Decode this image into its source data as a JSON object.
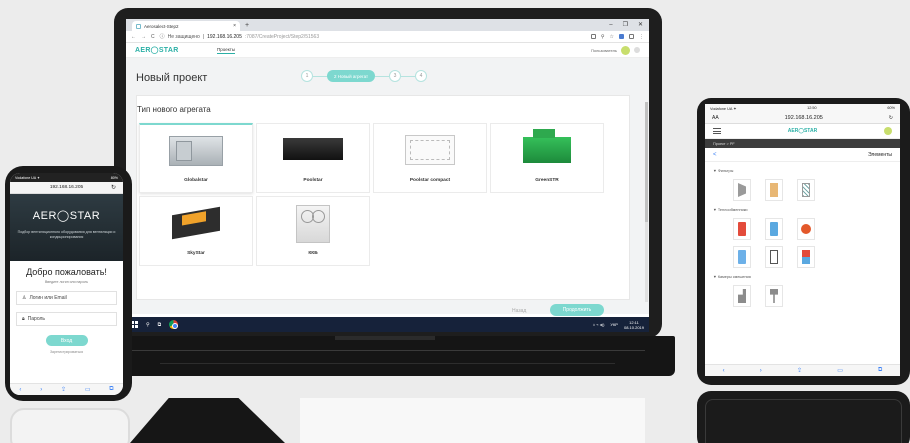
{
  "laptop": {
    "browser": {
      "tab_title": "Aerosalect-Step2",
      "new_tab": "+",
      "window_controls": [
        "–",
        "❐",
        "✕"
      ],
      "security_label": "Не защищено",
      "url_host": "192.168.16.205",
      "url_path": ":7087/CreateProject/Step2/51563"
    },
    "app": {
      "logo": "AER◯STAR",
      "nav_projects": "Проекты",
      "user_name": "Пользователь",
      "page_title": "Новый проект",
      "steps": {
        "first": "1",
        "active": "2 Новый агрегат",
        "third": "3",
        "fourth": "4"
      },
      "section_title": "Тип нового агрегата",
      "units": [
        {
          "name": "Globalstar"
        },
        {
          "name": "Poolstar"
        },
        {
          "name": "Poolstar compact"
        },
        {
          "name": "GreenSTR"
        },
        {
          "name": "SkyStar"
        },
        {
          "name": "ККБ"
        }
      ],
      "back_button": "Назад",
      "next_button": "Продолжить"
    },
    "taskbar": {
      "lang": "УКР",
      "time": "12:11",
      "date": "08.10.2019"
    }
  },
  "phone": {
    "status_left": "Vodafone UA ✦",
    "status_right": "80%",
    "url": "192.168.16.205",
    "logo": "AER◯STAR",
    "tagline": "Подбор вентиляционного оборудования для вентиляции и кондиционирования",
    "welcome": "Добро пожаловать!",
    "subtitle": "Введите логин или пароль",
    "login_placeholder": "Логин или Email",
    "password_placeholder": "Пароль",
    "login_button": "Вход",
    "register_link": "Зарегистрироваться"
  },
  "tablet": {
    "status_left": "Vodafone UA ✦",
    "status_time": "12:50",
    "status_right": "60%",
    "aa": "AA",
    "url": "192.168.16.205",
    "logo": "AER◯STAR",
    "breadcrumb": "Проект > PF",
    "back": "<",
    "section": "Элементы",
    "groups": [
      "▼ Фильтры",
      "▼ Теплообменники",
      "▼ Камеры смешения"
    ]
  },
  "colors": {
    "accent": "#7dd8cf",
    "brand": "#2bb0a6",
    "dark": "#1e1e1e"
  }
}
